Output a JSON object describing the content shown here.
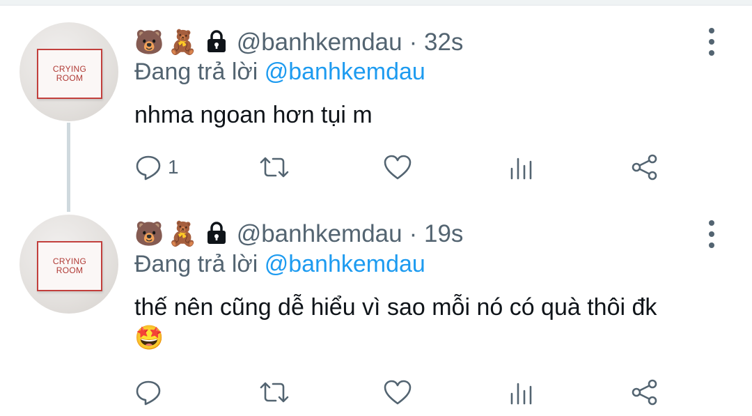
{
  "tweets": [
    {
      "emojis": [
        "🐻",
        "🧸"
      ],
      "lock_icon": "lock-icon",
      "handle": "@banhkemdau",
      "time": "· 32s",
      "replying_prefix": "Đang trả lời",
      "replying_to": "@banhkemdau",
      "text": "nhma ngoan hơn tụi m",
      "trailing_emoji": "",
      "avatar_sign": [
        "CRYING",
        "ROOM"
      ],
      "reply_count": "1"
    },
    {
      "emojis": [
        "🐻",
        "🧸"
      ],
      "lock_icon": "lock-icon",
      "handle": "@banhkemdau",
      "time": "· 19s",
      "replying_prefix": "Đang trả lời",
      "replying_to": "@banhkemdau",
      "text": "thế nên cũng dễ hiểu vì sao mỗi nó có quà thôi đk",
      "trailing_emoji": "🤩",
      "avatar_sign": [
        "CRYING",
        "ROOM"
      ],
      "reply_count": ""
    }
  ],
  "icons": {
    "reply": "reply-icon",
    "retweet": "retweet-icon",
    "like": "heart-icon",
    "views": "analytics-icon",
    "share": "share-icon",
    "more": "more-vertical-icon"
  },
  "colors": {
    "link": "#1d9bf0",
    "secondary_text": "#536471",
    "thread_line": "#cfd9de"
  }
}
